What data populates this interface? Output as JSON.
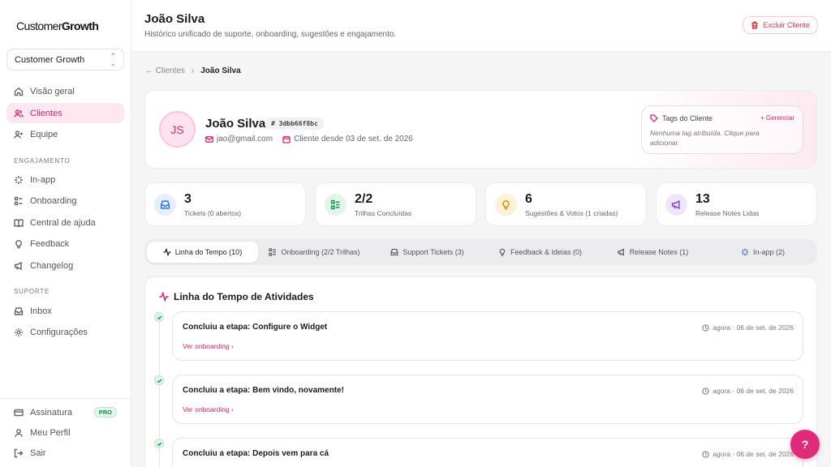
{
  "brand": {
    "name_regular": "Customer",
    "name_bold": "Growth"
  },
  "workspace": {
    "selected": "Customer Growth"
  },
  "nav": {
    "main": [
      {
        "label": "Visão geral",
        "icon": "home-icon"
      },
      {
        "label": "Clientes",
        "icon": "users-icon",
        "active": true
      },
      {
        "label": "Equipe",
        "icon": "user-plus-icon"
      }
    ],
    "engagement_label": "ENGAJAMENTO",
    "engagement": [
      {
        "label": "In-app",
        "icon": "sparkles-icon"
      },
      {
        "label": "Onboarding",
        "icon": "list-checks-icon"
      },
      {
        "label": "Central de ajuda",
        "icon": "book-icon"
      },
      {
        "label": "Feedback",
        "icon": "lightbulb-icon"
      },
      {
        "label": "Changelog",
        "icon": "megaphone-icon"
      }
    ],
    "support_label": "SUPORTE",
    "support": [
      {
        "label": "Inbox",
        "icon": "inbox-icon"
      },
      {
        "label": "Configurações",
        "icon": "gear-icon"
      }
    ],
    "footer": [
      {
        "label": "Assinatura",
        "icon": "credit-card-icon",
        "badge": "PRO"
      },
      {
        "label": "Meu Perfil",
        "icon": "user-icon"
      },
      {
        "label": "Sair",
        "icon": "logout-icon"
      }
    ]
  },
  "header": {
    "title": "João Silva",
    "subtitle": "Histórico unificado de suporte, onboarding, sugestões e engajamento.",
    "delete_label": "Excluir Cliente"
  },
  "breadcrumb": {
    "back": "← Clientes",
    "separator": "›",
    "current": "João Silva"
  },
  "customer": {
    "initials": "JS",
    "name": "João Silva",
    "id": "# 3dbb66f8bc",
    "email": "jao@gmail.com",
    "since": "Cliente desde 03 de set. de 2026"
  },
  "tags": {
    "title": "Tags do Cliente",
    "manage": "+ Gerenciar",
    "empty": "Nenhuma tag atribuída. Clique para adicionar."
  },
  "stats": [
    {
      "value": "3",
      "label": "Tickets (0 abertos)",
      "icon": "inbox-icon",
      "color": "#3b7bd8",
      "bg": "#e6effb"
    },
    {
      "value": "2/2",
      "label": "Trilhas Concluídas",
      "icon": "list-checks-icon",
      "color": "#1f9a5a",
      "bg": "#e3f5ea"
    },
    {
      "value": "6",
      "label": "Sugestões & Votos (1 criadas)",
      "icon": "lightbulb-icon",
      "color": "#d99a12",
      "bg": "#fcf1d9"
    },
    {
      "value": "13",
      "label": "Release Notes Lidas",
      "icon": "megaphone-icon",
      "color": "#8a4bd6",
      "bg": "#f0e6fb"
    }
  ],
  "tabs": [
    {
      "label": "Linha do Tempo (10)",
      "icon": "activity-icon",
      "active": true
    },
    {
      "label": "Onboarding (2/2 Trilhas)",
      "icon": "list-checks-icon"
    },
    {
      "label": "Support Tickets (3)",
      "icon": "inbox-icon"
    },
    {
      "label": "Feedback & Ideias (0)",
      "icon": "lightbulb-icon"
    },
    {
      "label": "Release Notes (1)",
      "icon": "megaphone-icon"
    },
    {
      "label": "In-app (2)",
      "icon": "sparkles-icon"
    }
  ],
  "activity": {
    "title": "Linha do Tempo de Atividades",
    "events": [
      {
        "title": "Concluiu a etapa: Configure o Widget",
        "time": "agora · 06 de set. de 2026",
        "link": "Ver onboarding  ›"
      },
      {
        "title": "Concluiu a etapa: Bem vindo, novamente!",
        "time": "agora · 06 de set. de 2026",
        "link": "Ver onboarding  ›"
      },
      {
        "title": "Concluiu a etapa: Depois vem para cá",
        "time": "agora · 06 de set. de 2026",
        "link": ""
      }
    ]
  },
  "help": {
    "label": "?"
  },
  "colors": {
    "accent": "#d4266e",
    "success": "#2a9a5a",
    "danger": "#d73a49"
  }
}
